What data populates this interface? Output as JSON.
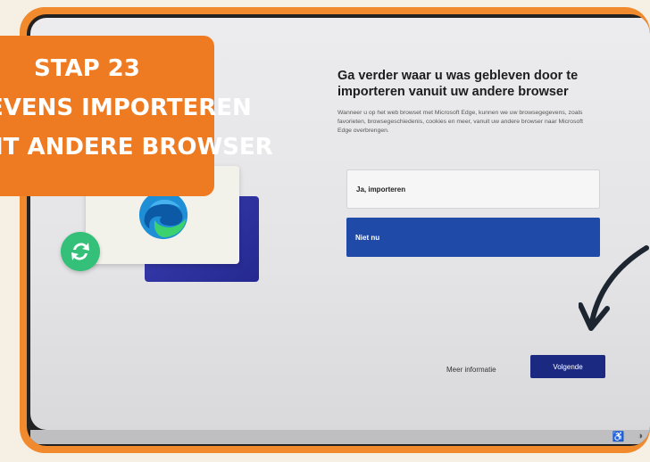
{
  "annotation": {
    "line1": "Stap 23",
    "line2": "evens importeren",
    "line3": "it andere browser"
  },
  "setup": {
    "title": "Ga verder waar u was gebleven door te importeren vanuit uw andere browser",
    "description": "Wanneer u op het web browset met Microsoft Edge, kunnen we uw browsegegevens, zoals favorieten, browsegeschiedenis, cookies en meer, vanuit uw andere browser naar Microsoft Edge overbrengen.",
    "options": [
      {
        "label": "Ja, importeren"
      },
      {
        "label": "Niet nu"
      }
    ],
    "more_info": "Meer informatie",
    "next": "Volgende"
  },
  "colors": {
    "frame_orange": "#f08a2c",
    "selected_blue": "#1f4aa8",
    "button_navy": "#1b2a80",
    "sync_green": "#35c07a"
  },
  "icons": [
    "edge-logo-icon",
    "sync-icon",
    "arrow-icon"
  ]
}
